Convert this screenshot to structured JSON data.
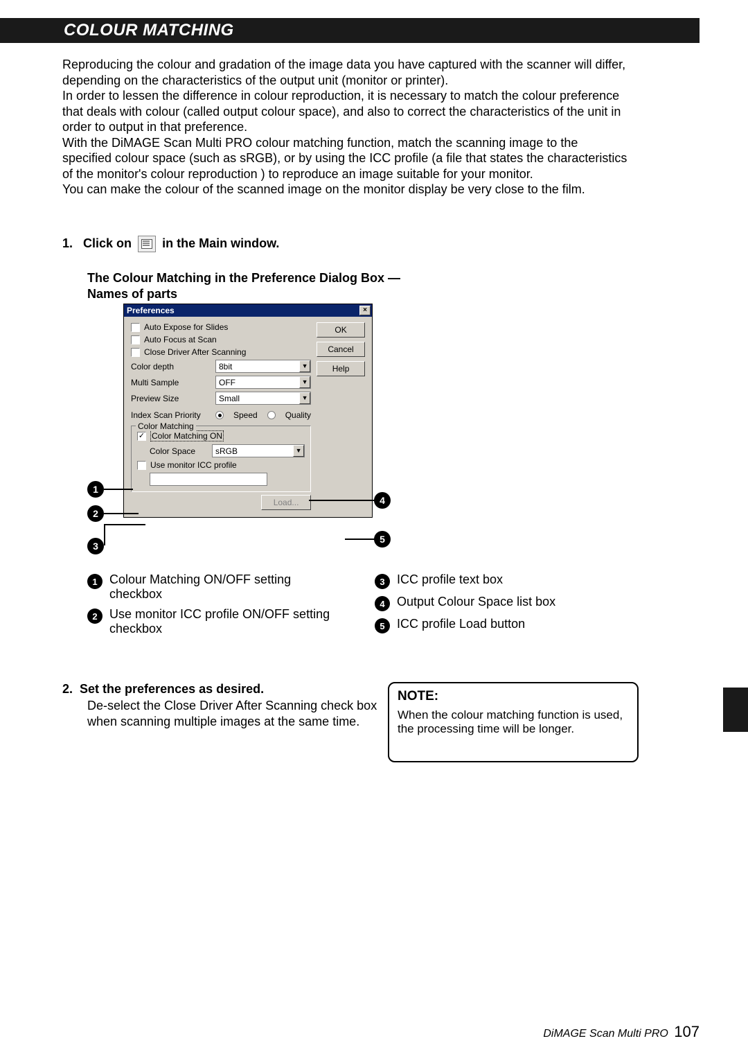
{
  "header": {
    "title": "COLOUR MATCHING"
  },
  "intro": {
    "p1": "Reproducing the colour and gradation of the image data you have captured with the scanner will differ, depending on the characteristics of the output unit (monitor or printer).",
    "p2": "In order to lessen the difference in colour reproduction, it is necessary to match the colour preference that deals with colour (called output colour space), and also to correct the characteristics of the unit in order to output in that preference.",
    "p3": "With the DiMAGE Scan Multi PRO colour matching function, match the scanning image to the specified colour space (such as sRGB), or by using the ICC profile (a file that states the characteristics of the monitor's colour reproduction ) to reproduce an image suitable for your monitor.",
    "p4": "You can make the colour of the scanned image on the monitor display be very close to the film."
  },
  "step1": {
    "num": "1.",
    "pre": "Click on",
    "post": "in the Main window."
  },
  "caption": {
    "l1": "The Colour Matching in the Preference Dialog Box —",
    "l2": "Names of parts"
  },
  "dialog": {
    "title": "Preferences",
    "close": "×",
    "buttons": {
      "ok": "OK",
      "cancel": "Cancel",
      "help": "Help"
    },
    "checks": {
      "autoExpose": "Auto Expose for Slides",
      "autoFocus": "Auto Focus at Scan",
      "closeDriver": "Close Driver After Scanning"
    },
    "rows": {
      "colorDepth": {
        "label": "Color depth",
        "value": "8bit"
      },
      "multiSample": {
        "label": "Multi Sample",
        "value": "OFF"
      },
      "previewSize": {
        "label": "Preview Size",
        "value": "Small"
      },
      "indexScan": {
        "label": "Index Scan Priority",
        "optSpeed": "Speed",
        "optQuality": "Quality"
      }
    },
    "group": {
      "legend": "Color Matching",
      "cmOn": "Color Matching ON",
      "colorSpaceLabel": "Color Space",
      "colorSpaceValue": "sRGB",
      "useMonitor": "Use monitor ICC profile",
      "load": "Load..."
    }
  },
  "callouts": {
    "n1": "1",
    "n2": "2",
    "n3": "3",
    "n4": "4",
    "n5": "5"
  },
  "legend": {
    "i1": "Colour Matching ON/OFF setting checkbox",
    "i2": "Use monitor ICC profile ON/OFF setting checkbox",
    "i3": "ICC profile text box",
    "i4": "Output Colour Space list box",
    "i5": "ICC profile Load button"
  },
  "step2": {
    "num": "2.",
    "head": "Set the preferences as desired.",
    "sub": "De-select the Close Driver After Scanning check box when scanning multiple images at the same time."
  },
  "note": {
    "title": "NOTE:",
    "body": "When the colour matching function is used, the processing time will be longer."
  },
  "footer": {
    "product": "DiMAGE Scan Multi PRO",
    "page": "107"
  }
}
